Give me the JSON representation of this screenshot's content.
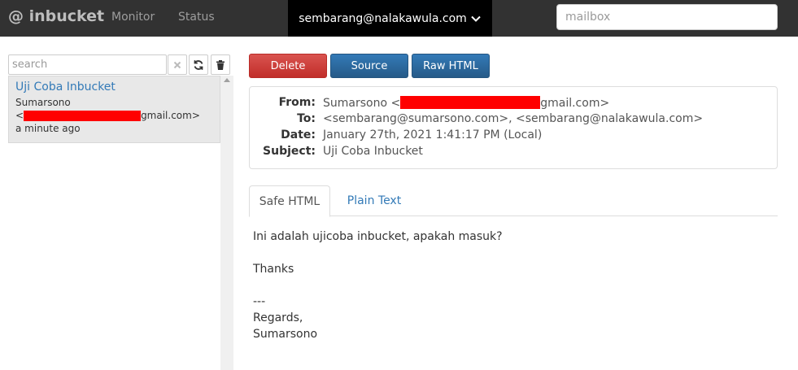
{
  "nav": {
    "brand": "@ inbucket",
    "monitor": "Monitor",
    "status": "Status",
    "current_mailbox": "sembarang@nalakawula.com",
    "mailbox_placeholder": "mailbox"
  },
  "sidebar": {
    "search_placeholder": "search",
    "messages": [
      {
        "subject": "Uji Coba Inbucket",
        "from_name": "Sumarsono",
        "from_prefix": "<",
        "from_suffix": "gmail.com>",
        "date": "a minute ago"
      }
    ]
  },
  "toolbar": {
    "delete": "Delete",
    "source": "Source",
    "raw_html": "Raw HTML"
  },
  "message": {
    "from_label": "From:",
    "from_name": "Sumarsono <",
    "from_suffix": "gmail.com>",
    "to_label": "To:",
    "to_value": "<sembarang@sumarsono.com>, <sembarang@nalakawula.com>",
    "date_label": "Date:",
    "date_value": "January 27th, 2021 1:41:17 PM (Local)",
    "subject_label": "Subject:",
    "subject_value": "Uji Coba Inbucket"
  },
  "tabs": {
    "safe_html": "Safe HTML",
    "plain_text": "Plain Text"
  },
  "body": {
    "lines": [
      "Ini adalah ujicoba inbucket, apakah masuk?",
      "",
      "Thanks",
      "",
      "---",
      "Regards,",
      "Sumarsono"
    ]
  },
  "colors": {
    "navbar": "#323232",
    "redaction": "#ff0000",
    "link": "#337ab7",
    "delete": "#d9534f"
  }
}
